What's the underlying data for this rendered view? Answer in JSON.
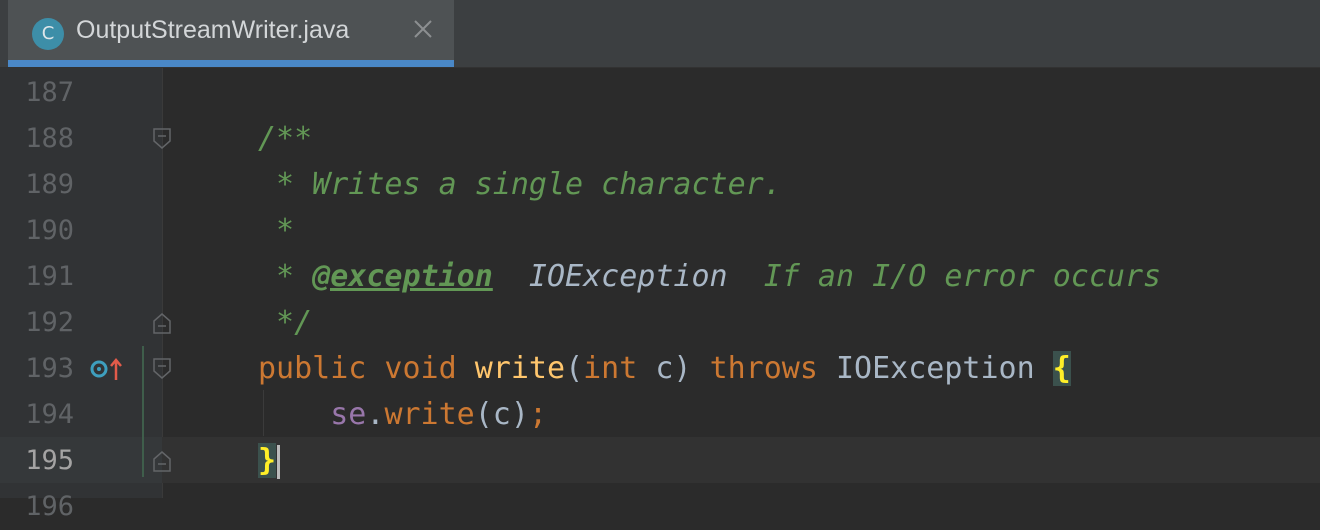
{
  "tab": {
    "icon_letter": "C",
    "title": "OutputStreamWriter.java",
    "close_icon": "close-icon"
  },
  "editor": {
    "lines": [
      {
        "number": "187"
      },
      {
        "number": "188"
      },
      {
        "number": "189"
      },
      {
        "number": "190"
      },
      {
        "number": "191"
      },
      {
        "number": "192"
      },
      {
        "number": "193"
      },
      {
        "number": "194"
      },
      {
        "number": "195"
      },
      {
        "number": "196"
      }
    ],
    "code": {
      "l188": "/**",
      "l189": " * Writes a single character.",
      "l190": " *",
      "l191_star": " * ",
      "l191_tag": "@exception",
      "l191_ref": "  IOException",
      "l191_text": "  If an I/O error occurs",
      "l192": " */",
      "l193_public": "public",
      "l193_void": " void ",
      "l193_write": "write",
      "l193_open": "(",
      "l193_int": "int",
      "l193_param": " c) ",
      "l193_throws": "throws",
      "l193_exc": " IOException ",
      "l193_brace": "{",
      "l194_indent": "    ",
      "l194_se": "se",
      "l194_dot": ".",
      "l194_write": "write",
      "l194_args": "(c)",
      "l194_semi": ";",
      "l195_brace": "}"
    },
    "current_line": "195"
  },
  "colors": {
    "background": "#2b2b2b",
    "gutter": "#313335",
    "tab_active": "#4e5254",
    "tab_underline": "#4a88c7",
    "doc_comment": "#629755",
    "keyword": "#cc7832",
    "method": "#ffc66d",
    "field": "#9876aa",
    "text": "#a9b7c6"
  }
}
